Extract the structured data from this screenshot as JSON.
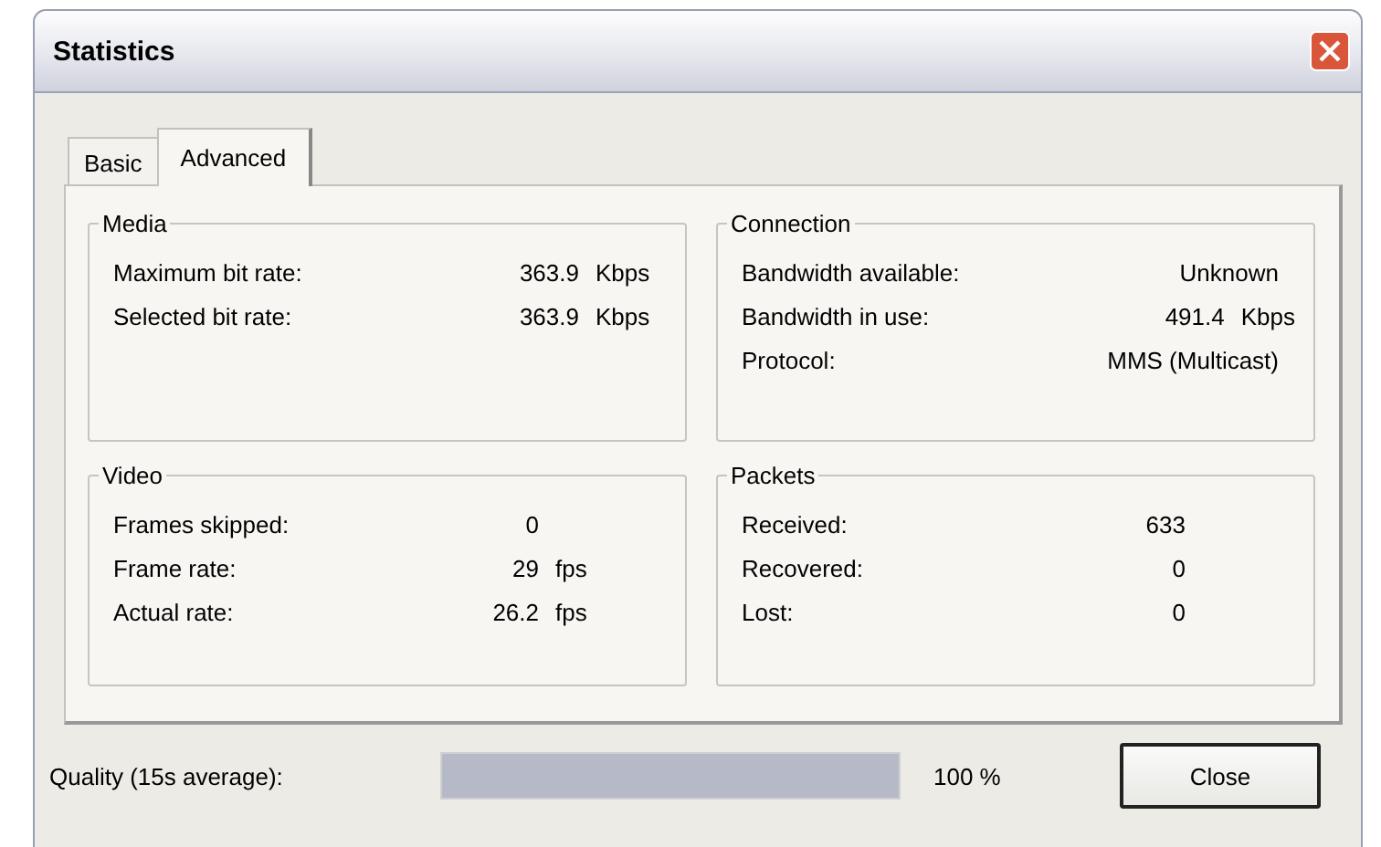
{
  "window": {
    "title": "Statistics"
  },
  "tabs": [
    {
      "label": "Basic",
      "selected": false
    },
    {
      "label": "Advanced",
      "selected": true
    }
  ],
  "groups": [
    {
      "title": "Media",
      "rows": [
        {
          "label": "Maximum bit rate:",
          "value": "363.9",
          "unit": "Kbps"
        },
        {
          "label": "Selected bit rate:",
          "value": "363.9",
          "unit": "Kbps"
        }
      ]
    },
    {
      "title": "Connection",
      "rows": [
        {
          "label": "Bandwidth available:",
          "value": "Unknown"
        },
        {
          "label": "Bandwidth in use:",
          "value": "491.4",
          "unit": "Kbps"
        },
        {
          "label": "Protocol:",
          "value": "MMS (Multicast)"
        }
      ]
    },
    {
      "title": "Video",
      "rows": [
        {
          "label": "Frames skipped:",
          "value": "0"
        },
        {
          "label": "Frame rate:",
          "value": "29",
          "unit": "fps"
        },
        {
          "label": "Actual rate:",
          "value": "26.2",
          "unit": "fps"
        }
      ]
    },
    {
      "title": "Packets",
      "rows": [
        {
          "label": "Received:",
          "value": "633"
        },
        {
          "label": "Recovered:",
          "value": "0"
        },
        {
          "label": "Lost:",
          "value": "0"
        }
      ]
    }
  ],
  "quality": {
    "label": "Quality (15s average):",
    "level": 1.0,
    "reading": "100 %"
  },
  "buttons": [
    "Close"
  ]
}
